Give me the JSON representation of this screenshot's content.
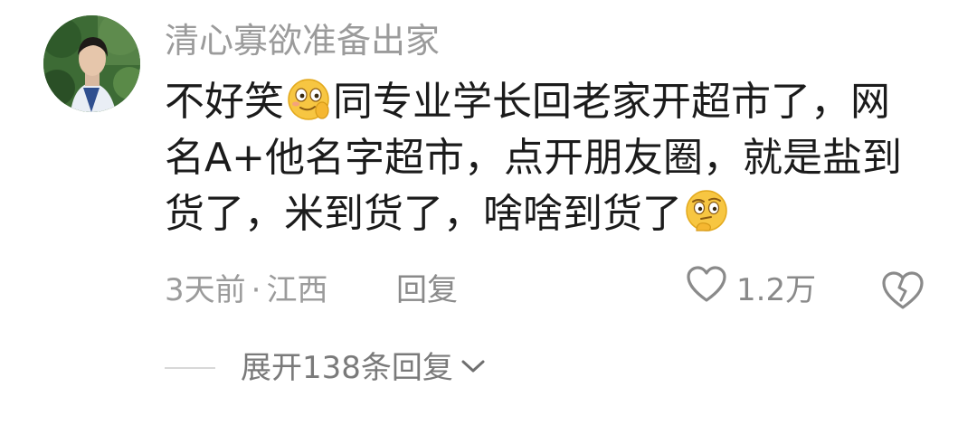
{
  "comment": {
    "username": "清心寡欲准备出家",
    "content_lines": [
      {
        "before": "不好笑",
        "emoji": "smirk-face-emoji",
        "after": "同专业学长回老家开超市了，网"
      },
      {
        "text": "名A+他名字超市，点开朋友圈，就是盐到"
      },
      {
        "before": "货了，米到货了，啥啥到货了",
        "emoji": "thinking-face-emoji",
        "after": ""
      }
    ],
    "time": "3天前",
    "separator": "·",
    "location": "江西",
    "reply_label": "回复",
    "like_count": "1.2万",
    "like_icon": "heart-outline-icon",
    "dislike_icon": "broken-heart-icon"
  },
  "replies": {
    "expand_label": "展开138条回复",
    "expand_icon": "chevron-down-icon"
  },
  "colors": {
    "text_primary": "#1b1b1b",
    "text_secondary": "#9b9b9b",
    "emoji_yellow": "#f7c642"
  }
}
